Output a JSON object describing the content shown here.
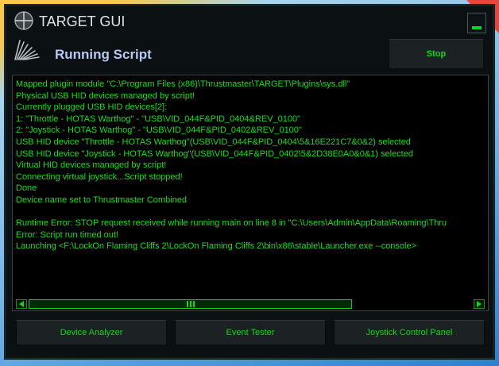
{
  "window": {
    "title": "TARGET GUI"
  },
  "header": {
    "status_title": "Running Script",
    "stop_label": "Stop"
  },
  "console": {
    "lines": [
      "Mapped plugin module \"C:\\Program Files (x86)\\Thrustmaster\\TARGET\\Plugins\\sys.dll\"",
      "Physical USB HID devices managed by script!",
      "Currently plugged USB HID devices[2]:",
      "1: \"Throttle - HOTAS Warthog\" - \"USB\\VID_044F&PID_0404&REV_0100\"",
      "2: \"Joystick - HOTAS Warthog\" - \"USB\\VID_044F&PID_0402&REV_0100\"",
      "USB HID device \"Throttle - HOTAS Warthog\"(USB\\VID_044F&PID_0404\\5&16E221C7&0&2) selected",
      "USB HID device \"Joystick - HOTAS Warthog\"(USB\\VID_044F&PID_0402\\5&2D38E0A0&0&1) selected",
      "Virtual HID devices managed by script!",
      "Connecting virtual joystick...Script stopped!",
      "Done",
      "Device name set to Thrustmaster Combined",
      "",
      "Runtime Error: STOP request received while running main on line 8 in \"C:\\Users\\Admin\\AppData\\Roaming\\Thru",
      "Error: Script run timed out!",
      "Launching <F:\\LockOn Flaming Cliffs 2\\LockOn Flaming Cliffs 2\\bin\\x86\\stable\\Launcher.exe --console>"
    ],
    "text": ""
  },
  "footer": {
    "buttons": [
      {
        "label": "Device Analyzer"
      },
      {
        "label": "Event Tester"
      },
      {
        "label": "Joystick Control Panel"
      }
    ]
  },
  "colors": {
    "accent_green": "#16d41a",
    "title_blue": "#b9c7f3",
    "window_bg": "#0b1113"
  },
  "icons": {
    "app": "crosshair-icon",
    "logo": "thrustmaster-logo-icon",
    "scroll_left": "arrow-left-icon",
    "scroll_right": "arrow-right-icon"
  }
}
